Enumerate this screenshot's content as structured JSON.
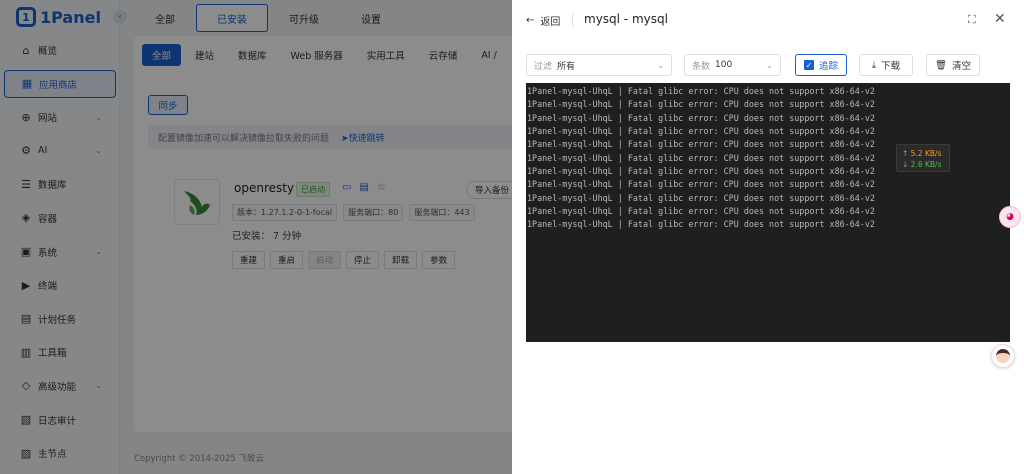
{
  "brand": {
    "name": "1Panel",
    "collapse_icon": "chevron-left-icon"
  },
  "sidebar": {
    "items": [
      {
        "label": "概览",
        "icon": "home-icon",
        "has_chevron": false
      },
      {
        "label": "应用商店",
        "icon": "apps-icon",
        "has_chevron": false,
        "active": true
      },
      {
        "label": "网站",
        "icon": "globe-icon",
        "has_chevron": true
      },
      {
        "label": "AI",
        "icon": "robot-icon",
        "has_chevron": true
      },
      {
        "label": "数据库",
        "icon": "database-icon",
        "has_chevron": false
      },
      {
        "label": "容器",
        "icon": "container-icon",
        "has_chevron": false
      },
      {
        "label": "系统",
        "icon": "system-icon",
        "has_chevron": true
      },
      {
        "label": "终端",
        "icon": "terminal-icon",
        "has_chevron": false
      },
      {
        "label": "计划任务",
        "icon": "calendar-icon",
        "has_chevron": false
      },
      {
        "label": "工具箱",
        "icon": "toolbox-icon",
        "has_chevron": false
      },
      {
        "label": "高级功能",
        "icon": "diamond-icon",
        "has_chevron": true
      },
      {
        "label": "日志审计",
        "icon": "log-icon",
        "has_chevron": false
      },
      {
        "label": "主节点",
        "icon": "node-icon",
        "has_chevron": false
      }
    ]
  },
  "top_tabs": [
    "全部",
    "已安装",
    "可升级",
    "设置"
  ],
  "active_top_tab": "已安装",
  "sub_tabs": [
    "全部",
    "建站",
    "数据库",
    "Web 服务器",
    "实用工具",
    "云存储",
    "AI /"
  ],
  "sync_button": "同步",
  "hint": {
    "text": "配置镜像加速可以解决镜像拉取失败的问题",
    "link": "快速跳转"
  },
  "app": {
    "name": "openresty",
    "status": "已启动",
    "import_backup": "导入备份",
    "tags": [
      "版本：1.27.1.2-0-1-focal",
      "服务端口：80",
      "服务端口：443"
    ],
    "installed": "已安装：  7 分钟",
    "actions": [
      "重建",
      "重启",
      "启动",
      "停止",
      "卸载",
      "参数"
    ]
  },
  "copyright": "Copyright © 2014-2025 飞致云",
  "drawer": {
    "back_label": "返回",
    "title": "mysql - mysql",
    "filter": {
      "prefix": "过滤",
      "value": "所有"
    },
    "count": {
      "prefix": "条数",
      "value": "100"
    },
    "follow_label": "追踪",
    "download_label": "下载",
    "clear_label": "清空",
    "log_lines": [
      "1Panel-mysql-UhqL | Fatal glibc error: CPU does not support x86-64-v2",
      "1Panel-mysql-UhqL | Fatal glibc error: CPU does not support x86-64-v2",
      "1Panel-mysql-UhqL | Fatal glibc error: CPU does not support x86-64-v2",
      "1Panel-mysql-UhqL | Fatal glibc error: CPU does not support x86-64-v2",
      "1Panel-mysql-UhqL | Fatal glibc error: CPU does not support x86-64-v2",
      "1Panel-mysql-UhqL | Fatal glibc error: CPU does not support x86-64-v2",
      "1Panel-mysql-UhqL | Fatal glibc error: CPU does not support x86-64-v2",
      "1Panel-mysql-UhqL | Fatal glibc error: CPU does not support x86-64-v2",
      "1Panel-mysql-UhqL | Fatal glibc error: CPU does not support x86-64-v2",
      "1Panel-mysql-UhqL | Fatal glibc error: CPU does not support x86-64-v2",
      "1Panel-mysql-UhqL | Fatal glibc error: CPU does not support x86-64-v2"
    ]
  },
  "speed": {
    "up": "↑ 5.2 KB/s",
    "down": "↓ 2.6 KB/s"
  },
  "colors": {
    "accent": "#1a5fd0",
    "terminal_bg": "#1f1f1f",
    "up": "#f0a020",
    "down": "#4cc04c"
  }
}
